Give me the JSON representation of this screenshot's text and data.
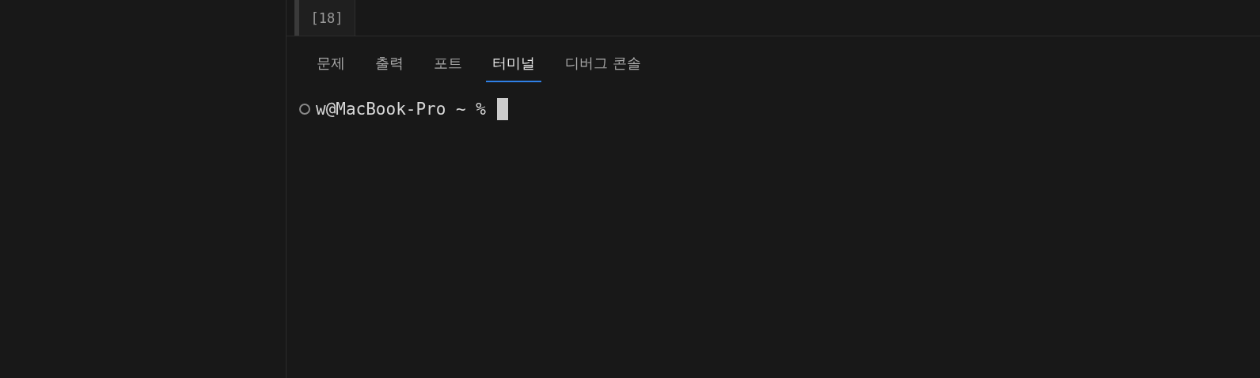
{
  "editor": {
    "cell_label": "[18]"
  },
  "panel_tabs": [
    {
      "label": "문제",
      "selected": false
    },
    {
      "label": "출력",
      "selected": false
    },
    {
      "label": "포트",
      "selected": false
    },
    {
      "label": "터미널",
      "selected": true
    },
    {
      "label": "디버그 콘솔",
      "selected": false
    }
  ],
  "terminal": {
    "prompt": "w@MacBook-Pro ~ %"
  }
}
